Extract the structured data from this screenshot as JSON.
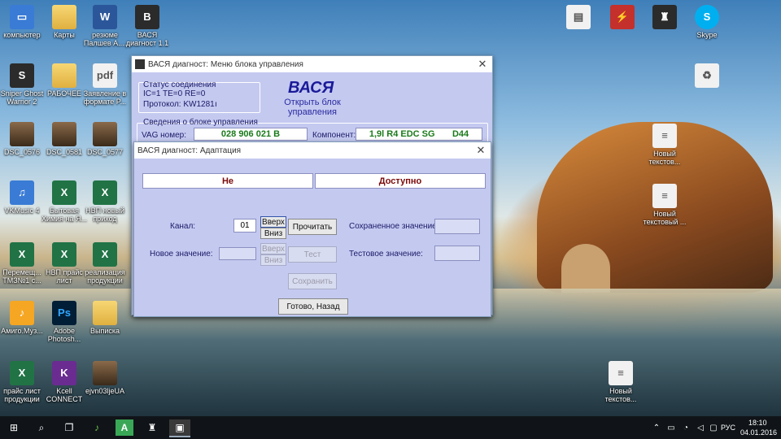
{
  "desktop": {
    "icons": [
      {
        "label": "компьютер",
        "icon": "computer-icon",
        "style": "blue",
        "glyph": "▭"
      },
      {
        "label": "Карты",
        "icon": "folder-icon",
        "style": "folder",
        "glyph": ""
      },
      {
        "label": "резюме Палшев А....",
        "icon": "word-doc-icon",
        "style": "word",
        "glyph": "W"
      },
      {
        "label": "ВАСЯ диагност 1.1",
        "icon": "vasya-app-icon",
        "style": "dark",
        "glyph": "В"
      },
      {
        "label": "Sniper Ghost Warrior 2",
        "icon": "game-icon",
        "style": "dark",
        "glyph": "S"
      },
      {
        "label": "РАБОЧЕЕ",
        "icon": "folder-icon",
        "style": "folder",
        "glyph": ""
      },
      {
        "label": "Заявление в формате P...",
        "icon": "pdf-icon",
        "style": "white",
        "glyph": "pdf"
      },
      {
        "label": "DSC_0576",
        "icon": "photo-icon",
        "style": "photo",
        "glyph": ""
      },
      {
        "label": "DSC_0581",
        "icon": "photo-icon",
        "style": "photo",
        "glyph": ""
      },
      {
        "label": "DSC_0577",
        "icon": "photo-icon",
        "style": "photo",
        "glyph": ""
      },
      {
        "label": "VKMusic 4",
        "icon": "music-app-icon",
        "style": "blue",
        "glyph": "♫"
      },
      {
        "label": "Бытовая Химия на Я...",
        "icon": "excel-icon",
        "style": "excel",
        "glyph": "X"
      },
      {
        "label": "НВП новый приход",
        "icon": "excel-icon",
        "style": "excel",
        "glyph": "X"
      },
      {
        "label": "Перемещ... ТМЗ№1 с...",
        "icon": "excel-icon",
        "style": "excel",
        "glyph": "X"
      },
      {
        "label": "НВП прайс лист",
        "icon": "excel-icon",
        "style": "excel",
        "glyph": "X"
      },
      {
        "label": "реализация продукции",
        "icon": "excel-icon",
        "style": "excel",
        "glyph": "X"
      },
      {
        "label": "Амиго.Муз...",
        "icon": "music-icon",
        "style": "orange",
        "glyph": "♪"
      },
      {
        "label": "Adobe Photosh...",
        "icon": "photoshop-icon",
        "style": "ps",
        "glyph": "Ps"
      },
      {
        "label": "Выписка",
        "icon": "folder-icon",
        "style": "folder",
        "glyph": ""
      },
      {
        "label": "прайс лист продукции",
        "icon": "excel-icon",
        "style": "excel",
        "glyph": "X"
      },
      {
        "label": "Kcell CONNECT",
        "icon": "kcell-icon",
        "style": "purple",
        "glyph": "K"
      },
      {
        "label": "ejvn03ljeUA",
        "icon": "photo-icon",
        "style": "photo",
        "glyph": ""
      },
      {
        "label": "",
        "icon": "fax-icon",
        "style": "white",
        "glyph": "▤"
      },
      {
        "label": "",
        "icon": "lightning-icon",
        "style": "red",
        "glyph": "⚡"
      },
      {
        "label": "",
        "icon": "tanks-icon",
        "style": "dark",
        "glyph": "♜"
      },
      {
        "label": "Skype",
        "icon": "skype-icon",
        "style": "sky",
        "glyph": "S"
      },
      {
        "label": "",
        "icon": "recycle-bin-icon",
        "style": "white",
        "glyph": "♻"
      },
      {
        "label": "Новый текстов...",
        "icon": "text-doc-icon",
        "style": "white",
        "glyph": "≡"
      },
      {
        "label": "Новый текстовый ...",
        "icon": "text-doc-icon",
        "style": "white",
        "glyph": "≡"
      },
      {
        "label": "Новый текстов...",
        "icon": "text-doc-icon",
        "style": "white",
        "glyph": "≡"
      }
    ]
  },
  "main_window": {
    "title": "ВАСЯ диагност: Меню блока управления",
    "status_group": {
      "title": "Статус соединения",
      "line1": "IC=1  TE=0  RE=0",
      "line2": "Протокол: KW1281",
      "cursor": "ı"
    },
    "brand": "ВАСЯ",
    "subtitle": "Открыть блок управления",
    "info_group": {
      "title": "Сведения о блоке управления",
      "vag_label": "VAG номер:",
      "vag_value": "028 906 021 B",
      "component_label": "Компонент:",
      "component_value": "1,9l R4 EDC SG       D44"
    }
  },
  "adapt_window": {
    "title": "ВАСЯ диагност: Адаптация",
    "status_left": "Не",
    "status_right": "Доступно",
    "channel_label": "Канал:",
    "channel_value": "01",
    "up": "Вверх",
    "down": "Вниз",
    "read": "Прочитать",
    "saved_label": "Сохраненное значение:",
    "new_label": "Новое значение:",
    "test": "Тест",
    "test_label": "Тестовое значение:",
    "save": "Сохранить",
    "done": "Готово, Назад"
  },
  "taskbar": {
    "lang": "РУС",
    "time": "18:10",
    "date": "04.01.2016"
  }
}
